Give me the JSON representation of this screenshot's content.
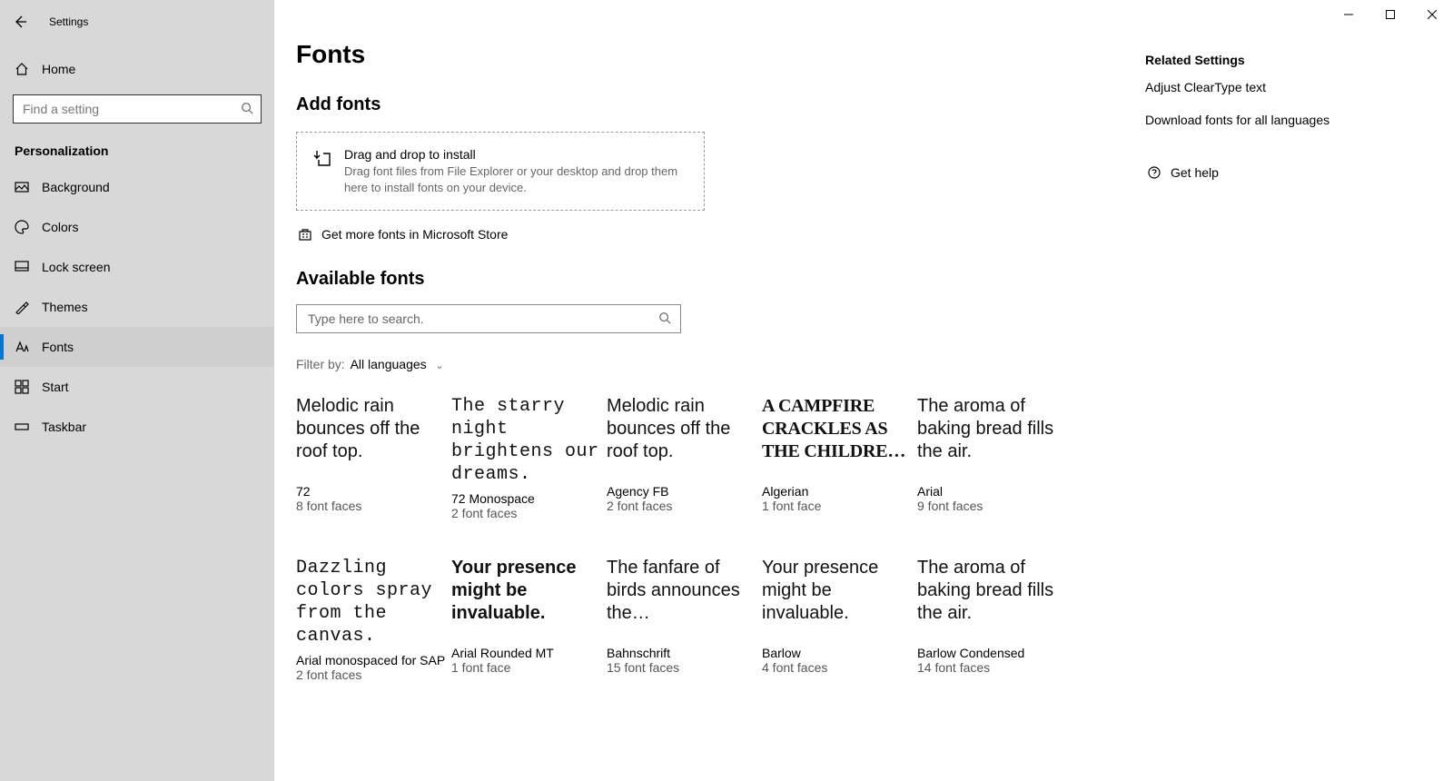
{
  "window": {
    "title": "Settings"
  },
  "sidebar": {
    "home": "Home",
    "search_placeholder": "Find a setting",
    "section": "Personalization",
    "items": [
      {
        "label": "Background"
      },
      {
        "label": "Colors"
      },
      {
        "label": "Lock screen"
      },
      {
        "label": "Themes"
      },
      {
        "label": "Fonts",
        "active": true
      },
      {
        "label": "Start"
      },
      {
        "label": "Taskbar"
      }
    ]
  },
  "page": {
    "title": "Fonts",
    "add_fonts_heading": "Add fonts",
    "dropzone_title": "Drag and drop to install",
    "dropzone_desc": "Drag font files from File Explorer or your desktop and drop them here to install fonts on your device.",
    "store_link": "Get more fonts in Microsoft Store",
    "available_heading": "Available fonts",
    "font_search_placeholder": "Type here to search.",
    "filter_label": "Filter by:",
    "filter_value": "All languages"
  },
  "fonts": [
    {
      "preview": "Melodic rain bounces off the roof top.",
      "name": "72",
      "faces": "8 font faces",
      "style": "sans"
    },
    {
      "preview": "The starry night brightens our dreams.",
      "name": "72 Monospace",
      "faces": "2 font faces",
      "style": "mono"
    },
    {
      "preview": "Melodic rain bounces off the roof top.",
      "name": "Agency FB",
      "faces": "2 font faces",
      "style": "condensed"
    },
    {
      "preview": "A campfire crackles as the childre…",
      "name": "Algerian",
      "faces": "1 font face",
      "style": "deco"
    },
    {
      "preview": "The aroma of baking bread fills the air.",
      "name": "Arial",
      "faces": "9 font faces",
      "style": "sans"
    },
    {
      "preview": "Dazzling colors spray from the canvas.",
      "name": "Arial monospaced for SAP",
      "faces": "2 font faces",
      "style": "mono"
    },
    {
      "preview": "Your presence might be invaluable.",
      "name": "Arial Rounded MT",
      "faces": "1 font face",
      "style": "sans bold"
    },
    {
      "preview": "The fanfare of birds announces the…",
      "name": "Bahnschrift",
      "faces": "15 font faces",
      "style": "bahn"
    },
    {
      "preview": "Your presence might be invaluable.",
      "name": "Barlow",
      "faces": "4 font faces",
      "style": "barlow"
    },
    {
      "preview": "The aroma of baking bread fills the air.",
      "name": "Barlow Condensed",
      "faces": "14 font faces",
      "style": "arialnarrow"
    }
  ],
  "related": {
    "heading": "Related Settings",
    "link1": "Adjust ClearType text",
    "link2": "Download fonts for all languages",
    "help": "Get help"
  }
}
